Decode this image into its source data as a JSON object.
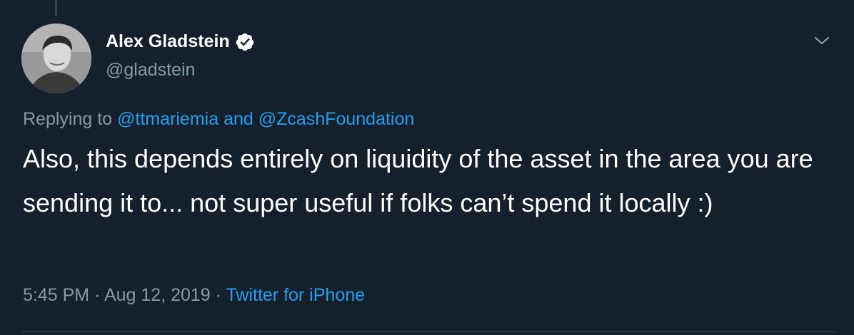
{
  "tweet": {
    "author": {
      "display_name": "Alex Gladstein",
      "handle": "@gladstein",
      "verified": true
    },
    "reply": {
      "prefix": "Replying to",
      "mention_1": "@ttmariemia",
      "conjunction": "and",
      "mention_2": "@ZcashFoundation"
    },
    "text": "Also, this depends entirely on liquidity of the asset in the area you are sending it to... not super useful if folks can’t spend it locally :)",
    "time": "5:45 PM",
    "separator": "·",
    "date": "Aug 12, 2019",
    "source": "Twitter for iPhone"
  },
  "icons": {
    "verified": "verified-badge-icon",
    "menu": "chevron-down-icon"
  },
  "colors": {
    "background": "#15202b",
    "text": "#ffffff",
    "secondary_text": "#8899a6",
    "link": "#1da1f2",
    "divider": "#38444d"
  }
}
